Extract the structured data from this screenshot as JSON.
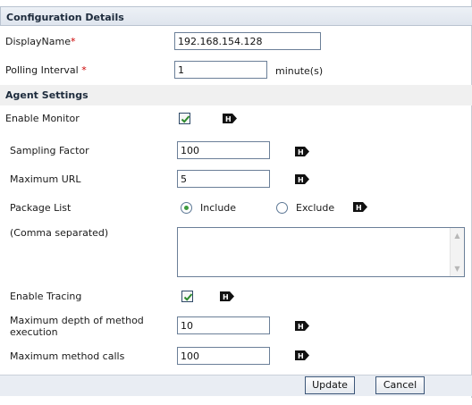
{
  "config_section": {
    "title": "Configuration Details",
    "display_name": {
      "label": "DisplayName",
      "required_mark": "*",
      "value": "192.168.154.128"
    },
    "polling_interval": {
      "label": "Polling Interval",
      "required_mark": "*",
      "value": "1",
      "unit": "minute(s)"
    }
  },
  "agent_section": {
    "title": "Agent Settings",
    "enable_monitor": {
      "label": "Enable Monitor",
      "checked": true
    },
    "sampling_factor": {
      "label": "Sampling Factor",
      "value": "100"
    },
    "maximum_url": {
      "label": "Maximum URL",
      "value": "5"
    },
    "package_list": {
      "label": "Package List",
      "options": [
        {
          "label": "Include",
          "selected": true
        },
        {
          "label": "Exclude",
          "selected": false
        }
      ],
      "note": "(Comma separated)",
      "text": ""
    },
    "enable_tracing": {
      "label": "Enable Tracing",
      "checked": true
    },
    "max_depth": {
      "label_line1": "Maximum depth of method",
      "label_line2": "execution",
      "value": "10"
    },
    "max_method_calls": {
      "label": "Maximum method calls",
      "value": "100"
    }
  },
  "buttons": {
    "update": "Update",
    "cancel": "Cancel"
  },
  "icons": {
    "help": "help-icon"
  },
  "colors": {
    "required": "#cc0000",
    "radio_selected": "#3d9a3d",
    "header_text": "#1d2b3c"
  }
}
